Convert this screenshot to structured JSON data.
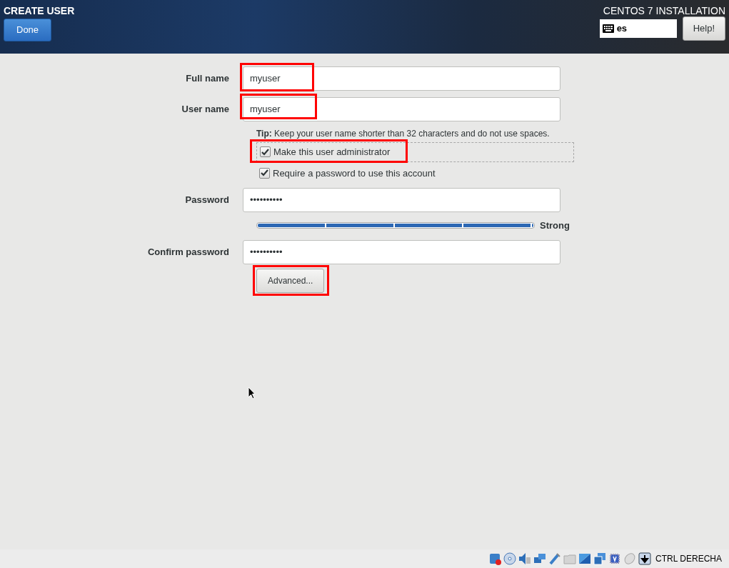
{
  "header": {
    "title": "CREATE USER",
    "done_button": "Done",
    "product": "CENTOS 7 INSTALLATION",
    "keyboard_layout": "es",
    "help_button": "Help!"
  },
  "fields": [
    {
      "label": "Full name",
      "value": "myuser",
      "highlighted": true
    },
    {
      "label": "User name",
      "value": "myuser",
      "highlighted": true
    }
  ],
  "tip": "**Tip:** Keep your user name shorter than 32 characters and do not use spaces.",
  "checkboxes": [
    {
      "label": "Make this user administrator",
      "checked": true,
      "highlighted": true,
      "focused": true
    },
    {
      "label": "Require a password to use this account",
      "checked": true,
      "highlighted": false,
      "focused": false
    }
  ],
  "password": {
    "label": "Password",
    "value": "••••••••••"
  },
  "strength": {
    "level": 1,
    "reading": "Strong"
  },
  "confirm": {
    "label": "Confirm password",
    "value": "••••••••••"
  },
  "advanced_button": {
    "label": "Advanced...",
    "highlighted": true
  },
  "status_bar": {
    "host_key": "CTRL DERECHA"
  }
}
